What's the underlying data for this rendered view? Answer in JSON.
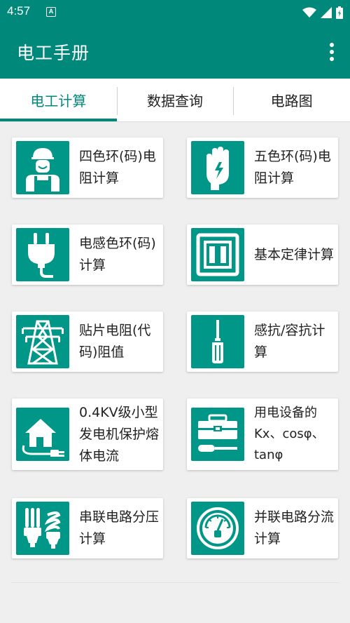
{
  "status": {
    "time": "4:57",
    "notif_icon": "A"
  },
  "app": {
    "title": "电工手册",
    "accent": "#00897b"
  },
  "tabs": [
    {
      "label": "电工计算"
    },
    {
      "label": "数据查询"
    },
    {
      "label": "电路图"
    }
  ],
  "cards": [
    {
      "label": "四色环(码)电阻计算",
      "icon": "electrician-worker-icon"
    },
    {
      "label": "五色环(码)电阻计算",
      "icon": "insulated-glove-icon"
    },
    {
      "label": "电感色环(码)计算",
      "icon": "electric-plug-icon"
    },
    {
      "label": "基本定律计算",
      "icon": "wall-switch-icon"
    },
    {
      "label": "贴片电阻(代码)阻值",
      "icon": "transmission-tower-icon"
    },
    {
      "label": "感抗/容抗计算",
      "icon": "screwdriver-icon"
    },
    {
      "label": "0.4KV级小型发电机保护熔体电流",
      "icon": "house-plug-icon"
    },
    {
      "label": "用电设备的Kx、cosφ、tanφ",
      "icon": "toolbox-icon"
    },
    {
      "label": "串联电路分压计算",
      "icon": "energy-saving-bulb-icon"
    },
    {
      "label": "并联电路分流计算",
      "icon": "meter-gauge-icon"
    }
  ]
}
